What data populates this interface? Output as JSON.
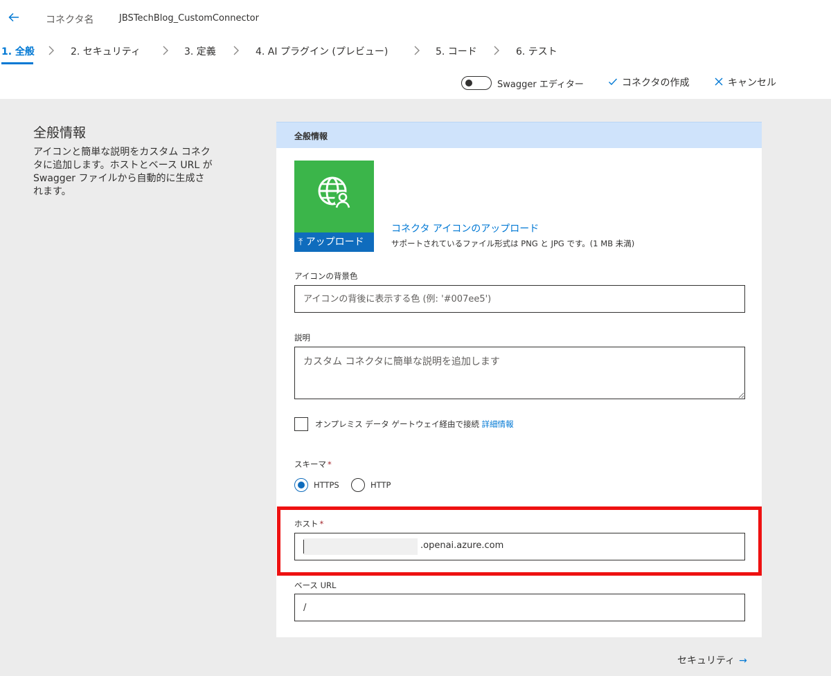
{
  "header": {
    "connector_name_label": "コネクタ名",
    "connector_name_value": "JBSTechBlog_CustomConnector"
  },
  "steps": [
    {
      "label": "1. 全般",
      "active": true
    },
    {
      "label": "2. セキュリティ"
    },
    {
      "label": "3. 定義"
    },
    {
      "label": "4. AI プラグイン (プレビュー)"
    },
    {
      "label": "5. コード"
    },
    {
      "label": "6. テスト"
    }
  ],
  "toolbar": {
    "swagger_label": "Swagger エディター",
    "create_label": "コネクタの作成",
    "cancel_label": "キャンセル"
  },
  "sidebar": {
    "title": "全般情報",
    "description": "アイコンと簡単な説明をカスタム コネクタに追加します。ホストとベース URL が Swagger ファイルから自動的に生成されます。"
  },
  "card": {
    "header": "全般情報",
    "upload_button": "アップロード",
    "upload_link": "コネクタ アイコンのアップロード",
    "upload_hint": "サポートされているファイル形式は PNG と JPG です。(1 MB 未満)",
    "icon_bg_label": "アイコンの背景色",
    "icon_bg_placeholder": "アイコンの背後に表示する色 (例: '#007ee5')",
    "description_label": "説明",
    "description_placeholder": "カスタム コネクタに簡単な説明を追加します",
    "gateway_label": "オンプレミス データ ゲートウェイ経由で接続",
    "gateway_link": "詳細情報",
    "scheme_label": "スキーマ",
    "scheme_options": [
      "HTTPS",
      "HTTP"
    ],
    "scheme_selected": "HTTPS",
    "host_label": "ホスト",
    "host_suffix": ".openai.azure.com",
    "base_url_label": "ベース URL",
    "base_url_value": "/"
  },
  "footer": {
    "next_label": "セキュリティ"
  },
  "colors": {
    "accent": "#0078d4",
    "icon_tile": "#3bb54a",
    "highlight": "#ee1111"
  }
}
